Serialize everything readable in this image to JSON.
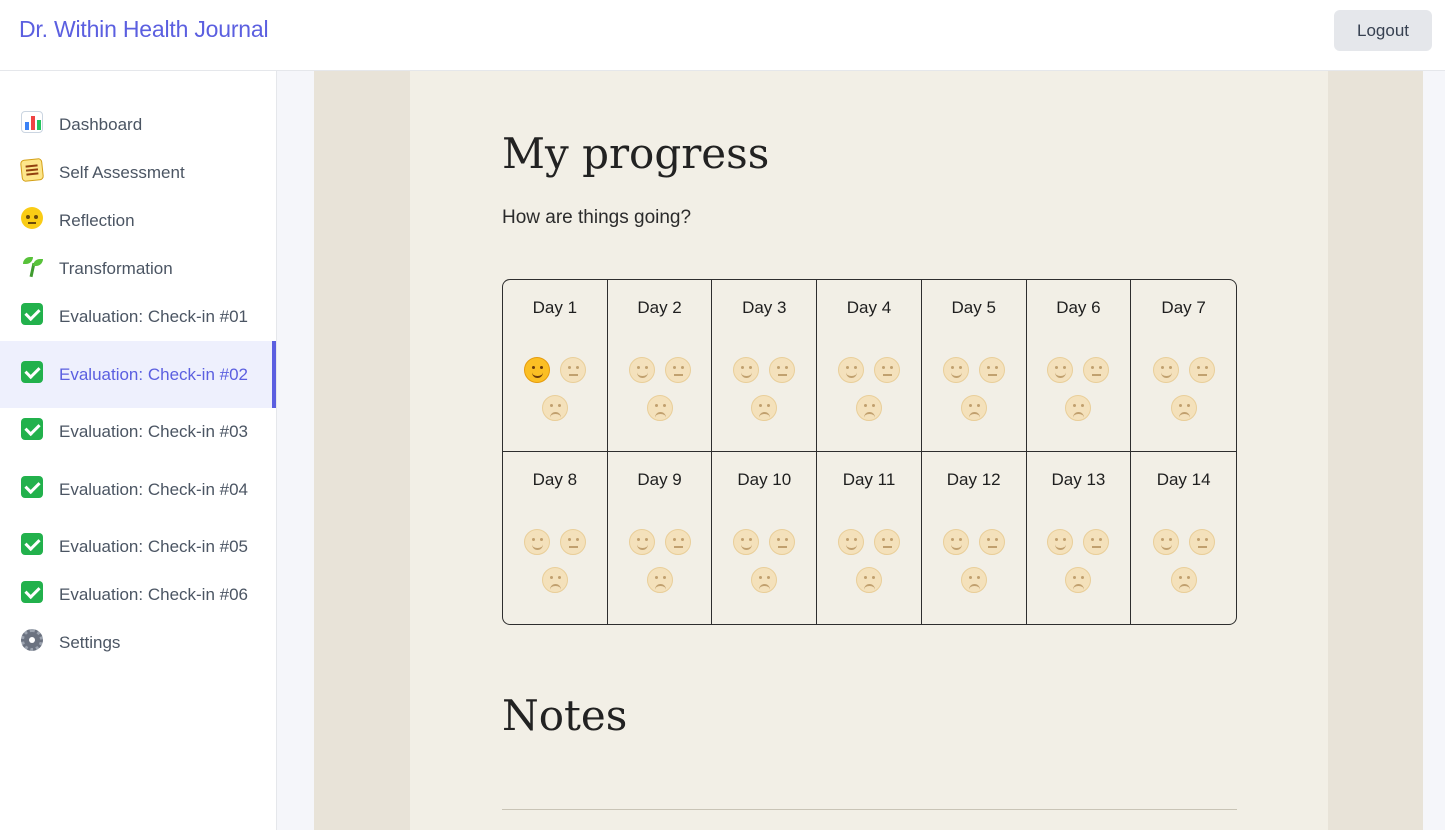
{
  "app": {
    "title": "Dr. Within Health Journal",
    "logout_label": "Logout"
  },
  "sidebar": {
    "items": [
      {
        "label": "Dashboard",
        "icon": "bar-chart-icon"
      },
      {
        "label": "Self Assessment",
        "icon": "memo-icon"
      },
      {
        "label": "Reflection",
        "icon": "thinking-face-icon"
      },
      {
        "label": "Transformation",
        "icon": "seedling-icon"
      },
      {
        "label": "Evaluation: Check-in #01",
        "icon": "check-mark-icon"
      },
      {
        "label": "Evaluation: Check-in #02",
        "icon": "check-mark-icon",
        "active": true
      },
      {
        "label": "Evaluation: Check-in #03",
        "icon": "check-mark-icon"
      },
      {
        "label": "Evaluation: Check-in #04",
        "icon": "check-mark-icon"
      },
      {
        "label": "Evaluation: Check-in #05",
        "icon": "check-mark-icon"
      },
      {
        "label": "Evaluation: Check-in #06",
        "icon": "check-mark-icon"
      },
      {
        "label": "Settings",
        "icon": "gear-icon"
      }
    ]
  },
  "main": {
    "title": "My progress",
    "subtitle": "How are things going?",
    "days": [
      {
        "label": "Day 1",
        "selected": "happy"
      },
      {
        "label": "Day 2",
        "selected": null
      },
      {
        "label": "Day 3",
        "selected": null
      },
      {
        "label": "Day 4",
        "selected": null
      },
      {
        "label": "Day 5",
        "selected": null
      },
      {
        "label": "Day 6",
        "selected": null
      },
      {
        "label": "Day 7",
        "selected": null
      },
      {
        "label": "Day 8",
        "selected": null
      },
      {
        "label": "Day 9",
        "selected": null
      },
      {
        "label": "Day 10",
        "selected": null
      },
      {
        "label": "Day 11",
        "selected": null
      },
      {
        "label": "Day 12",
        "selected": null
      },
      {
        "label": "Day 13",
        "selected": null
      },
      {
        "label": "Day 14",
        "selected": null
      }
    ],
    "notes_title": "Notes"
  },
  "colors": {
    "accent": "#5b5fe0",
    "paper": "#f2efe6",
    "desk": "#e8e3d8"
  }
}
